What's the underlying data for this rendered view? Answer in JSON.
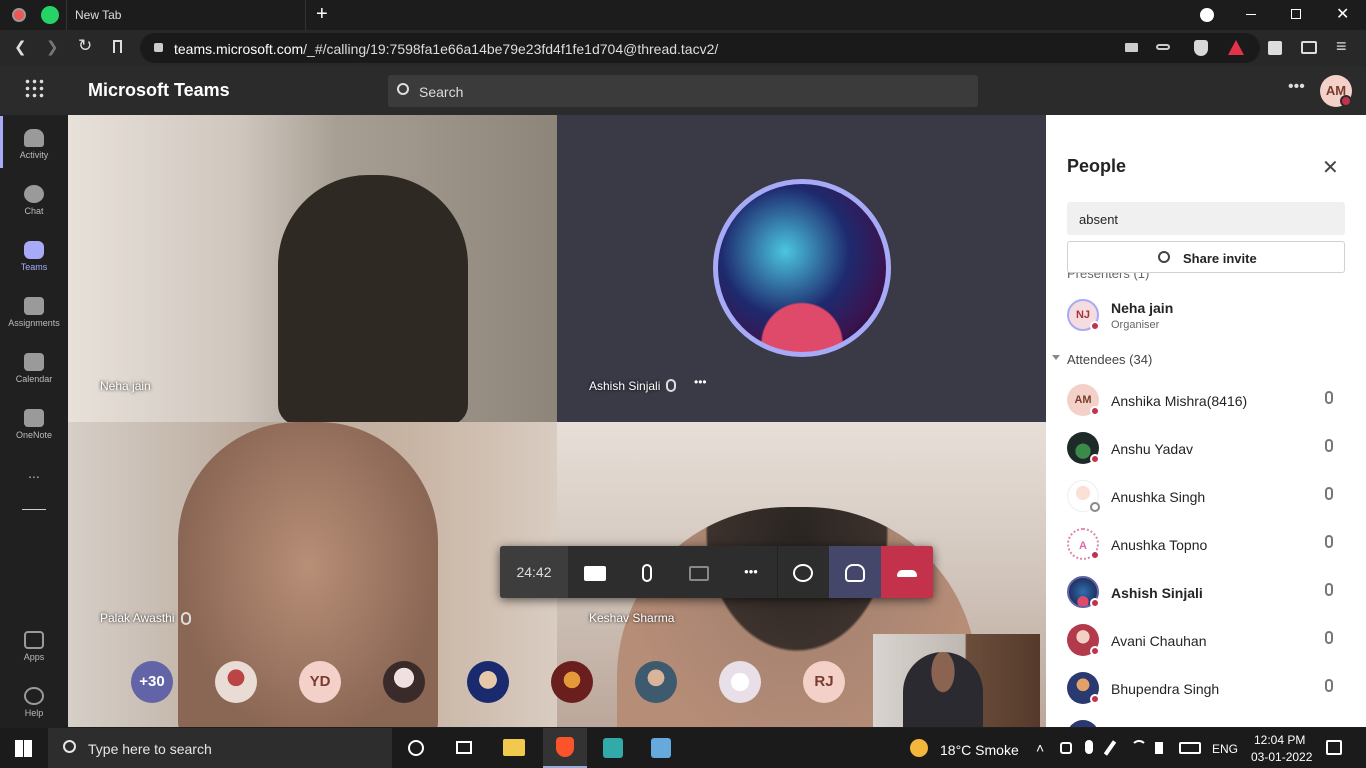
{
  "browser": {
    "tab_title": "New Tab",
    "url_domain": "teams.microsoft.com",
    "url_path": "/_#/calling/19:7598fa1e66a14be79e23fd4f1fe1d704@thread.tacv2/"
  },
  "teams": {
    "app_title": "Microsoft Teams",
    "search_placeholder": "Search",
    "user_initials": "AM"
  },
  "rail": {
    "items": [
      {
        "label": "Activity"
      },
      {
        "label": "Chat"
      },
      {
        "label": "Teams"
      },
      {
        "label": "Assignments"
      },
      {
        "label": "Calendar"
      },
      {
        "label": "OneNote"
      },
      {
        "label": "..."
      },
      {
        "label": "Apps"
      },
      {
        "label": "Help"
      }
    ]
  },
  "call": {
    "tiles": [
      {
        "name": "Neha jain"
      },
      {
        "name": "Ashish Sinjali"
      },
      {
        "name": "Palak Awasthi"
      },
      {
        "name": "Keshav Sharma"
      }
    ],
    "timer": "24:42",
    "overflow_count": "+30",
    "overflow_avatars": [
      {
        "initials": ""
      },
      {
        "initials": "YD"
      },
      {
        "initials": ""
      },
      {
        "initials": ""
      },
      {
        "initials": ""
      },
      {
        "initials": ""
      },
      {
        "initials": ""
      },
      {
        "initials": "RJ"
      }
    ]
  },
  "people": {
    "title": "People",
    "search_value": "absent",
    "share_invite": "Share invite",
    "presenters_header": "Presenters (1)",
    "presenter": {
      "initials": "NJ",
      "name": "Neha jain",
      "role": "Organiser"
    },
    "attendees_header": "Attendees (34)",
    "attendees": [
      {
        "initials": "AM",
        "name": "Anshika Mishra(8416)",
        "bold": false
      },
      {
        "initials": "",
        "name": "Anshu Yadav",
        "bold": false
      },
      {
        "initials": "",
        "name": "Anushka Singh",
        "bold": false
      },
      {
        "initials": "A",
        "name": "Anushka Topno",
        "bold": false
      },
      {
        "initials": "",
        "name": "Ashish Sinjali",
        "bold": true
      },
      {
        "initials": "",
        "name": "Avani Chauhan",
        "bold": false
      },
      {
        "initials": "",
        "name": "Bhupendra Singh",
        "bold": false
      }
    ]
  },
  "taskbar": {
    "search_placeholder": "Type here to search",
    "weather": "18°C  Smoke",
    "language": "ENG",
    "time": "12:04 PM",
    "date": "03-01-2022"
  },
  "colors": {
    "accent": "#a7aaf7",
    "end_call": "#c4314b",
    "teams_bar": "#2b2b2b"
  }
}
